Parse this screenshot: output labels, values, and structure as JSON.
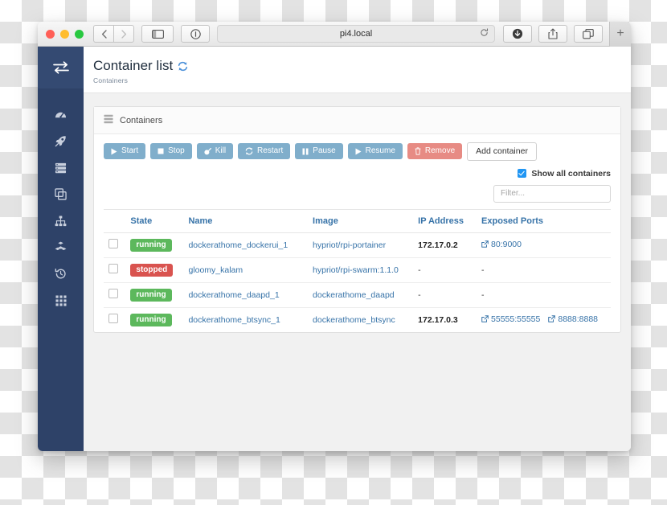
{
  "browser": {
    "url": "pi4.local",
    "back_icon": "chevron-left-icon",
    "forward_icon": "chevron-right-icon",
    "sidebar_toggle_icon": "sidebar-toggle-icon",
    "reader_icon": "reader-info-icon",
    "reload_icon": "reload-icon",
    "download_icon": "download-icon",
    "share_icon": "share-icon",
    "tabs_icon": "tab-overview-icon",
    "new_tab_label": "+"
  },
  "sidebar": {
    "brand_icon": "exchange-arrows-icon",
    "items": [
      {
        "icon": "dashboard-icon",
        "name": "dashboard"
      },
      {
        "icon": "rocket-icon",
        "name": "templates"
      },
      {
        "icon": "server-icon",
        "name": "containers"
      },
      {
        "icon": "clone-icon",
        "name": "images"
      },
      {
        "icon": "sitemap-icon",
        "name": "networks"
      },
      {
        "icon": "cubes-icon",
        "name": "volumes"
      },
      {
        "icon": "history-icon",
        "name": "events"
      },
      {
        "icon": "grid-icon",
        "name": "docker"
      }
    ]
  },
  "page": {
    "title": "Container list",
    "refresh_icon": "refresh-icon",
    "subtitle": "Containers"
  },
  "panel": {
    "header_icon": "server-list-icon",
    "header_title": "Containers",
    "actions": [
      {
        "label": "Start",
        "icon": "play-icon",
        "style": "primary"
      },
      {
        "label": "Stop",
        "icon": "stop-icon",
        "style": "primary"
      },
      {
        "label": "Kill",
        "icon": "kill-icon",
        "style": "primary"
      },
      {
        "label": "Restart",
        "icon": "restart-icon",
        "style": "primary"
      },
      {
        "label": "Pause",
        "icon": "pause-icon",
        "style": "primary"
      },
      {
        "label": "Resume",
        "icon": "play-icon",
        "style": "primary"
      },
      {
        "label": "Remove",
        "icon": "trash-icon",
        "style": "danger"
      },
      {
        "label": "Add container",
        "icon": "none",
        "style": "light"
      }
    ],
    "show_all_label": "Show all containers",
    "show_all_checked": true,
    "filter_placeholder": "Filter...",
    "columns": [
      "State",
      "Name",
      "Image",
      "IP Address",
      "Exposed Ports"
    ],
    "rows": [
      {
        "state": "running",
        "name": "dockerathome_dockerui_1",
        "image": "hypriot/rpi-portainer",
        "ip": "172.17.0.2",
        "ports": [
          "80:9000"
        ]
      },
      {
        "state": "stopped",
        "name": "gloomy_kalam",
        "image": "hypriot/rpi-swarm:1.1.0",
        "ip": "-",
        "ports": [
          "-"
        ]
      },
      {
        "state": "running",
        "name": "dockerathome_daapd_1",
        "image": "dockerathome_daapd",
        "ip": "-",
        "ports": [
          "-"
        ]
      },
      {
        "state": "running",
        "name": "dockerathome_btsync_1",
        "image": "dockerathome_btsync",
        "ip": "172.17.0.3",
        "ports": [
          "55555:55555",
          "8888:8888"
        ]
      }
    ]
  },
  "colors": {
    "sidebar": "#2e4268",
    "accent_link": "#3773a8",
    "btn_primary": "#80aecb",
    "btn_danger": "#e78b84",
    "badge_running": "#5cb85c",
    "badge_stopped": "#d9534f",
    "checkbox_checked": "#2196f3"
  }
}
